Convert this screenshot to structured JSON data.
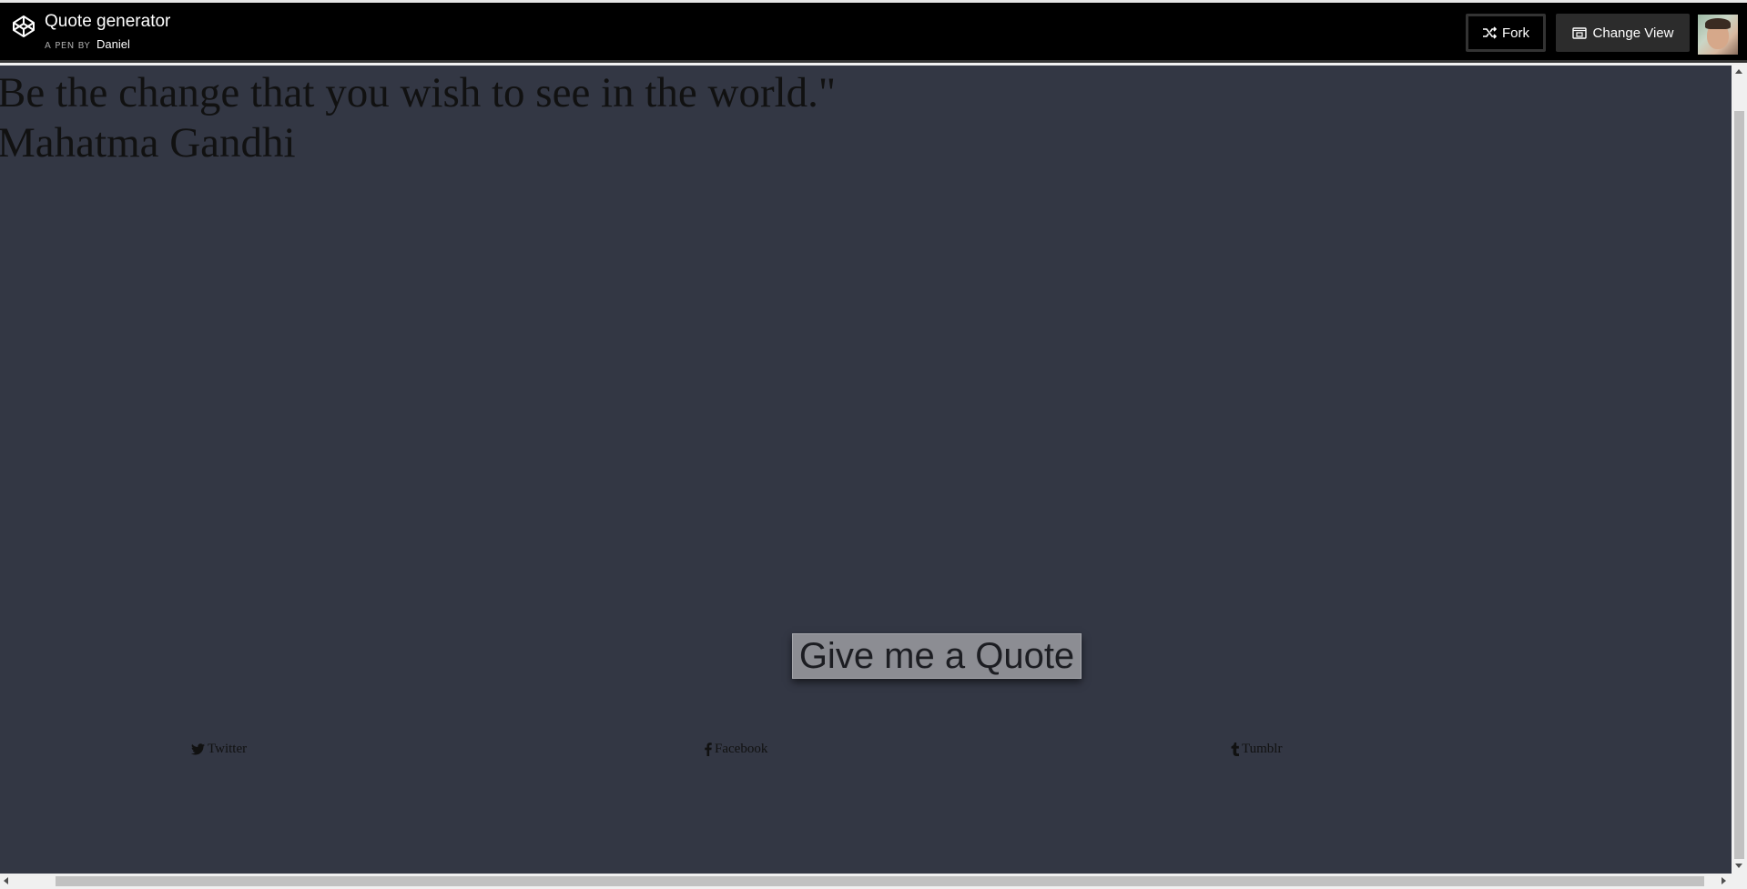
{
  "header": {
    "title": "Quote generator",
    "byline_prefix": "A PEN BY",
    "author": "Daniel",
    "fork_label": "Fork",
    "change_view_label": "Change View"
  },
  "quote": {
    "text": "Be the change that you wish to see in the world.\"",
    "author": "Mahatma Gandhi"
  },
  "actions": {
    "quote_button_label": "Give me a Quote"
  },
  "social": {
    "twitter_label": "Twitter",
    "facebook_label": "Facebook",
    "tumblr_label": "Tumblr"
  },
  "colors": {
    "header_bg": "#000000",
    "content_bg": "#333744",
    "button_bg": "#8c8d93"
  },
  "icons": [
    "codepen-logo-icon",
    "fork-icon",
    "change-view-icon",
    "twitter-icon",
    "facebook-icon",
    "tumblr-icon"
  ]
}
